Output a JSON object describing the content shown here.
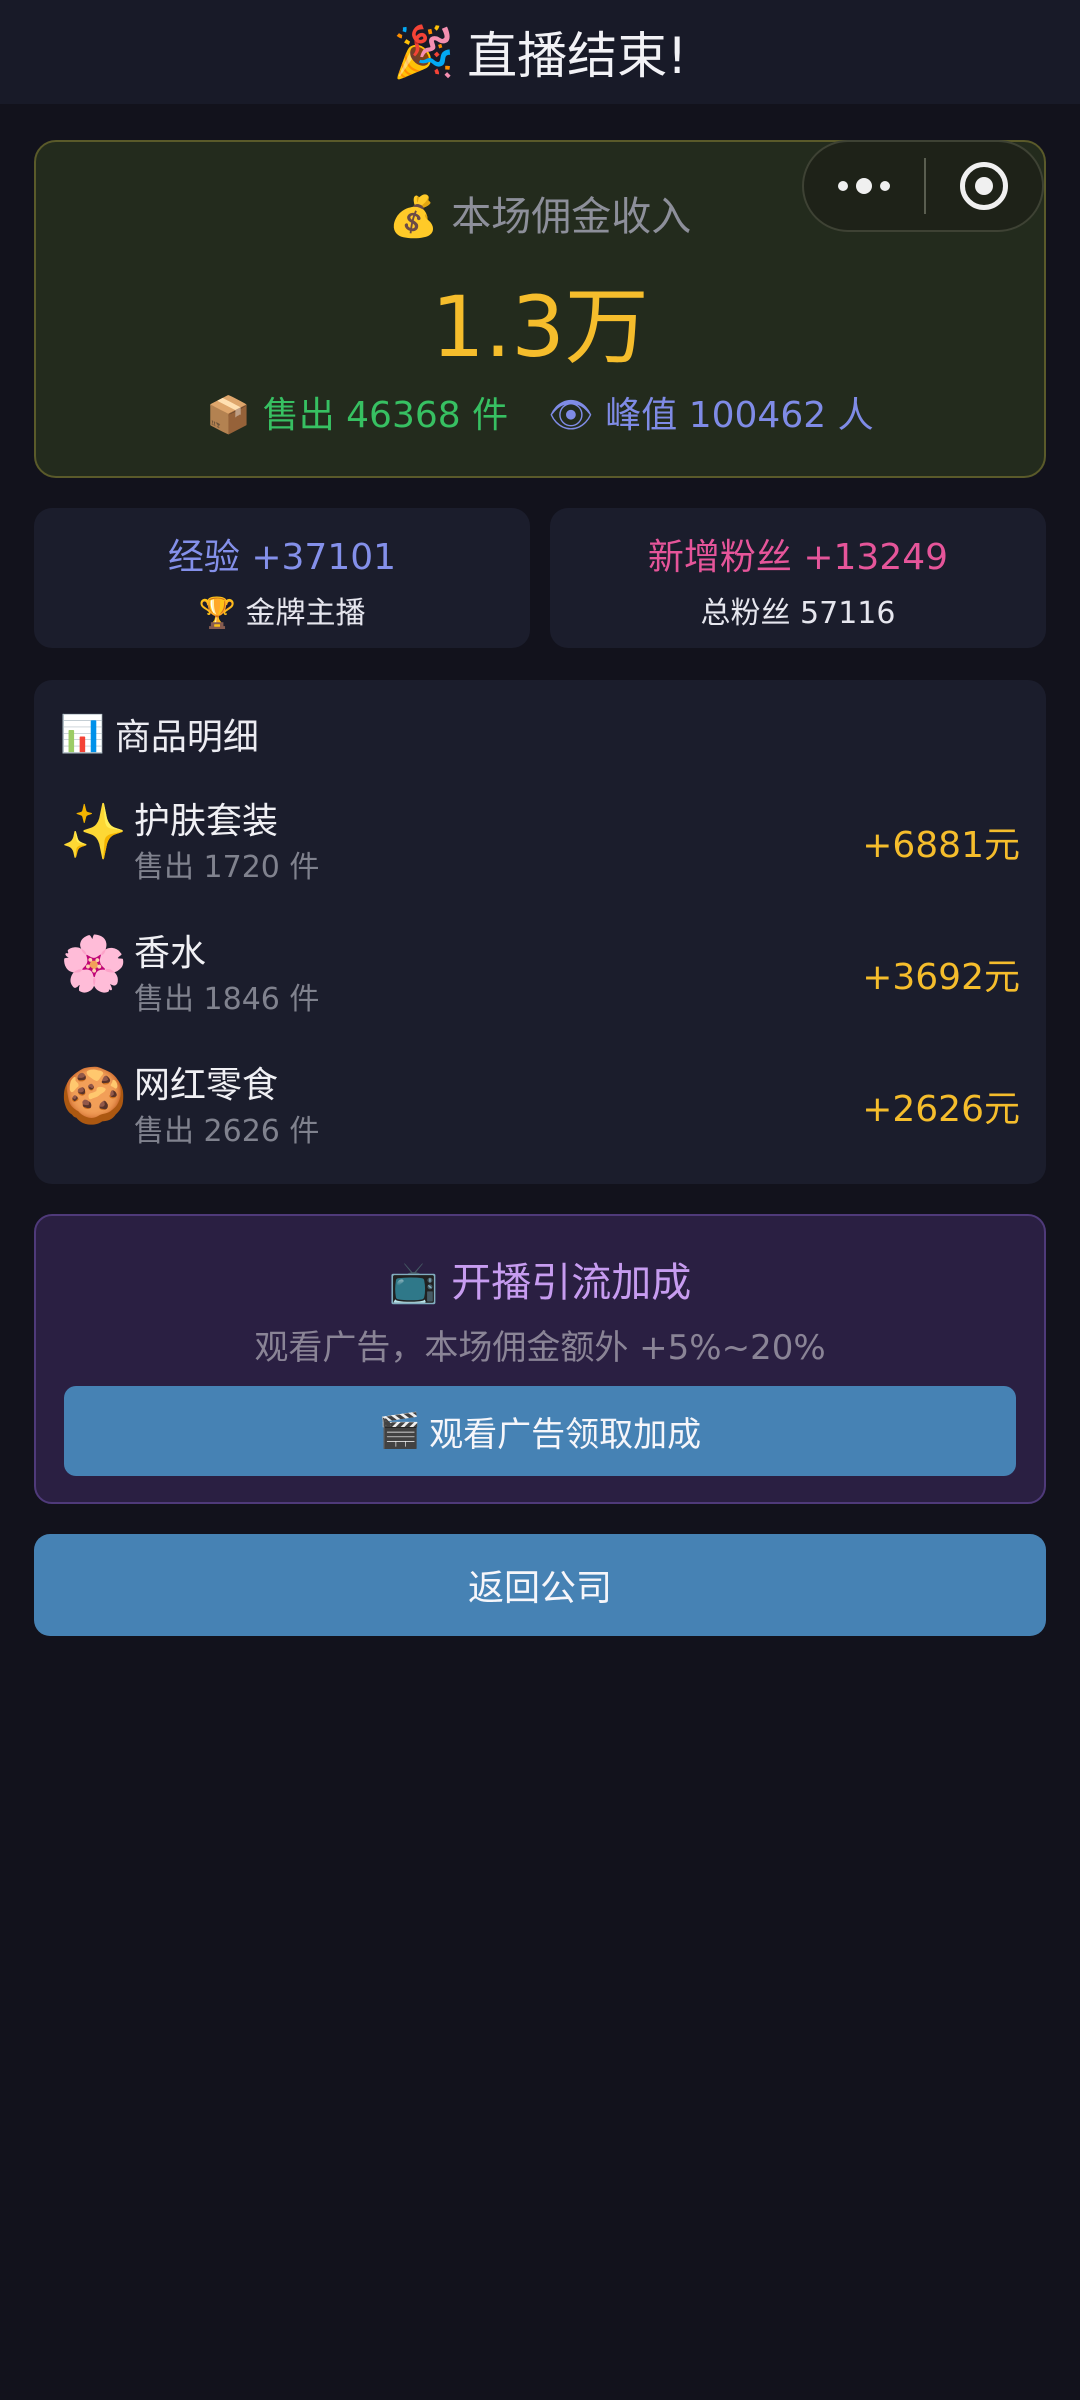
{
  "header": {
    "emoji": "🎉",
    "title": "直播结束!"
  },
  "income": {
    "emoji": "💰",
    "label": "本场佣金收入",
    "value": "1.3万",
    "sold_emoji": "📦",
    "sold_text": "售出 46368 件",
    "peak_emoji": "👁",
    "peak_text": "峰值 100462 人"
  },
  "experience": {
    "title": "经验 +37101",
    "badge_emoji": "🏆",
    "badge": "金牌主播"
  },
  "fans": {
    "title": "新增粉丝 +13249",
    "total": "总粉丝 57116"
  },
  "products": {
    "title_emoji": "📊",
    "title": "商品明细",
    "items": [
      {
        "emoji": "✨",
        "name": "护肤套装",
        "sold": "售出 1720 件",
        "earn": "+6881元"
      },
      {
        "emoji": "🌸",
        "name": "香水",
        "sold": "售出 1846 件",
        "earn": "+3692元"
      },
      {
        "emoji": "🍪",
        "name": "网红零食",
        "sold": "售出 2626 件",
        "earn": "+2626元"
      }
    ]
  },
  "boost": {
    "title_emoji": "📺",
    "title": "开播引流加成",
    "desc": "观看广告，本场佣金额外 +5%~20%",
    "button_emoji": "🎬",
    "button_label": "观看广告领取加成"
  },
  "return_button": "返回公司",
  "colors": {
    "accent_gold": "#f5bd2c",
    "sold_green": "#37c062",
    "peak_blue": "#7f8be6",
    "fans_pink": "#e6559a",
    "button_blue": "#4682b4",
    "boost_purple": "#c79cf0"
  }
}
